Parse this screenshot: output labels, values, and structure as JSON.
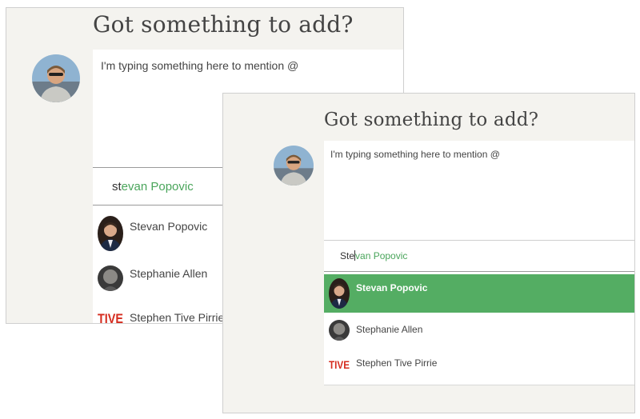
{
  "colors": {
    "panel_background": "#f4f3ef",
    "selected_suggestion": "#54ad63",
    "suggestion_text": "#4aa55b"
  },
  "back_view": {
    "heading": "Got something to add?",
    "avatar_icon": "user-photo",
    "compose_text": "I'm typing something here to mention @",
    "mention": {
      "typed": "st",
      "suggested": "evan Popovic"
    },
    "suggestions": [
      {
        "name": "Stevan Popovic",
        "icon": "person-photo"
      },
      {
        "name": "Stephanie Allen",
        "icon": "person-photo"
      },
      {
        "name": "Stephen Tive Pirrie",
        "logo": "TIVE"
      }
    ]
  },
  "front_view": {
    "heading": "Got something to add?",
    "avatar_icon": "user-photo",
    "compose_text": "I'm typing something here to mention @",
    "mention": {
      "typed": "Ste",
      "suggested": "van Popovic"
    },
    "selected_index": 0,
    "suggestions": [
      {
        "name": "Stevan Popovic",
        "icon": "person-photo"
      },
      {
        "name": "Stephanie Allen",
        "icon": "person-photo"
      },
      {
        "name": "Stephen Tive Pirrie",
        "logo": "TIVE"
      }
    ]
  }
}
